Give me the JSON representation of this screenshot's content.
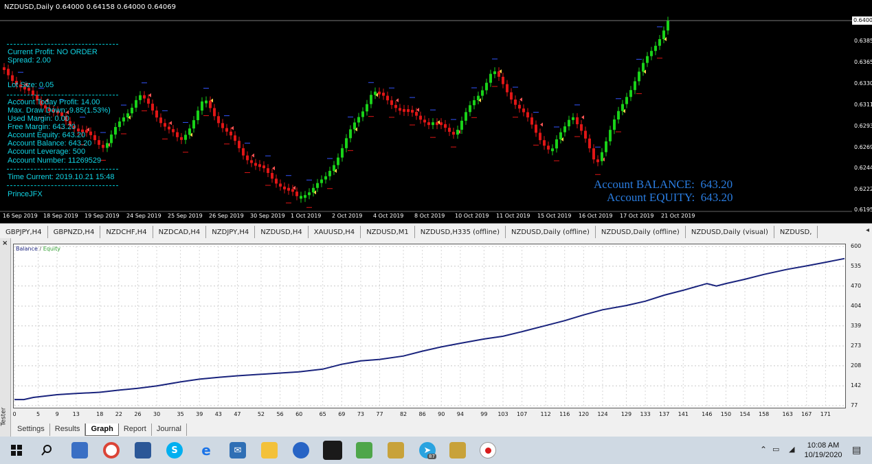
{
  "chart": {
    "symbol_title": "NZDUSD,Daily  0.64000 0.64158 0.64000 0.64069",
    "info_lines": [
      "Current Profit: NO ORDER",
      "Spread: 2.00",
      "Lot Size: 0.05",
      "Account Today Profit: 14.00",
      "Max. Draw Down: 9.85(1.53%)",
      "Used Margin: 0.00",
      "Free Margin: 643.20",
      "Account Equity: 643.20",
      "Account Balance: 643.20",
      "Account Leverage: 500",
      "Account Number: 11269529",
      "Time Current: 2019.10.21 15:48",
      "PrinceJFX"
    ],
    "account_balance_label": "Account BALANCE:",
    "account_balance_value": "643.20",
    "account_equity_label": "Account EQUITY:",
    "account_equity_value": "643.20",
    "current_price": "0.6400",
    "price_labels": [
      "0.6385",
      "0.6365",
      "0.6330",
      "0.6311",
      "0.6293",
      "0.6269",
      "0.6244",
      "0.6222",
      "0.6195"
    ],
    "date_labels": [
      "16 Sep 2019",
      "18 Sep 2019",
      "19 Sep 2019",
      "24 Sep 2019",
      "25 Sep 2019",
      "26 Sep 2019",
      "30 Sep 2019",
      "1 Oct 2019",
      "2 Oct 2019",
      "4 Oct 2019",
      "8 Oct 2019",
      "10 Oct 2019",
      "11 Oct 2019",
      "15 Oct 2019",
      "16 Oct 2019",
      "17 Oct 2019",
      "21 Oct 2019"
    ],
    "colors": {
      "bull": "#19d219",
      "bear": "#e01616",
      "info": "#12d6e6",
      "account": "#2a7de1"
    }
  },
  "symbol_tabs": [
    "GBPJPY,H4",
    "GBPNZD,H4",
    "NZDCHF,H4",
    "NZDCAD,H4",
    "NZDJPY,H4",
    "NZDUSD,H4",
    "XAUUSD,H4",
    "NZDUSD,M1",
    "NZDUSD,H335 (offline)",
    "NZDUSD,Daily (offline)",
    "NZDUSD,Daily (offline)",
    "NZDUSD,Daily (visual)",
    "NZDUSD,"
  ],
  "tester": {
    "side_label": "Tester",
    "close_glyph": "×",
    "legend_balance": "Balance",
    "legend_sep": " / ",
    "legend_equity": "Equity",
    "tabs": [
      "Settings",
      "Results",
      "Graph",
      "Report",
      "Journal"
    ],
    "active_tab": "Graph",
    "y_labels": [
      "600",
      "535",
      "470",
      "404",
      "339",
      "273",
      "208",
      "142",
      "77"
    ],
    "x_labels": [
      "0",
      "5",
      "9",
      "13",
      "18",
      "22",
      "26",
      "30",
      "35",
      "39",
      "43",
      "47",
      "52",
      "56",
      "60",
      "65",
      "69",
      "73",
      "77",
      "82",
      "86",
      "90",
      "94",
      "99",
      "103",
      "107",
      "112",
      "116",
      "120",
      "124",
      "129",
      "133",
      "137",
      "141",
      "146",
      "150",
      "154",
      "158",
      "163",
      "167",
      "171"
    ]
  },
  "chart_data": {
    "type": "line",
    "xlabel": "",
    "ylabel": "",
    "ylim": [
      77,
      600
    ],
    "xlim": [
      0,
      175
    ],
    "series": [
      {
        "name": "Balance",
        "x": [
          0,
          2,
          4,
          9,
          13,
          18,
          22,
          26,
          30,
          35,
          39,
          43,
          47,
          52,
          56,
          60,
          65,
          69,
          73,
          77,
          82,
          86,
          90,
          94,
          99,
          103,
          107,
          112,
          116,
          120,
          124,
          129,
          133,
          137,
          141,
          146,
          148,
          150,
          154,
          158,
          163,
          167,
          171,
          175
        ],
        "y": [
          97,
          97,
          104,
          113,
          117,
          121,
          128,
          134,
          142,
          155,
          164,
          170,
          175,
          180,
          184,
          188,
          197,
          213,
          224,
          229,
          240,
          256,
          270,
          282,
          296,
          305,
          320,
          340,
          356,
          375,
          392,
          406,
          420,
          440,
          456,
          478,
          470,
          478,
          492,
          508,
          525,
          536,
          548,
          560
        ]
      },
      {
        "name": "Equity",
        "x": [
          0,
          2,
          4,
          9,
          13,
          18,
          22,
          26,
          30,
          35,
          39,
          43,
          47,
          52,
          56,
          60,
          65,
          69,
          73,
          77,
          82,
          86,
          90,
          94,
          99,
          103,
          107,
          112,
          116,
          120,
          124,
          129,
          133,
          137,
          141,
          146,
          148,
          150,
          154,
          158,
          163,
          167,
          171,
          175
        ],
        "y": [
          97,
          97,
          104,
          113,
          117,
          121,
          128,
          134,
          142,
          155,
          164,
          170,
          175,
          180,
          184,
          188,
          197,
          213,
          224,
          229,
          240,
          256,
          270,
          282,
          296,
          305,
          320,
          340,
          356,
          375,
          392,
          406,
          420,
          440,
          456,
          478,
          470,
          478,
          492,
          508,
          525,
          536,
          548,
          560
        ]
      }
    ],
    "colors": {
      "Balance": "#1a237e",
      "Equity": "#2e9e2e"
    },
    "grid": true
  },
  "taskbar": {
    "time": "10:08 AM",
    "date": "10/19/2020",
    "icons": [
      "windows-start-icon",
      "search-icon",
      "file-manager-icon",
      "chrome-icon",
      "store-icon",
      "skype-icon",
      "edge-icon",
      "mail-icon",
      "file-explorer-icon",
      "metatrader-icon",
      "dark-terminal-icon",
      "trading-app-icon",
      "trading-app-icon-2",
      "telegram-icon",
      "trading-app-icon-3",
      "media-record-icon"
    ],
    "telegram_badge": "87"
  }
}
